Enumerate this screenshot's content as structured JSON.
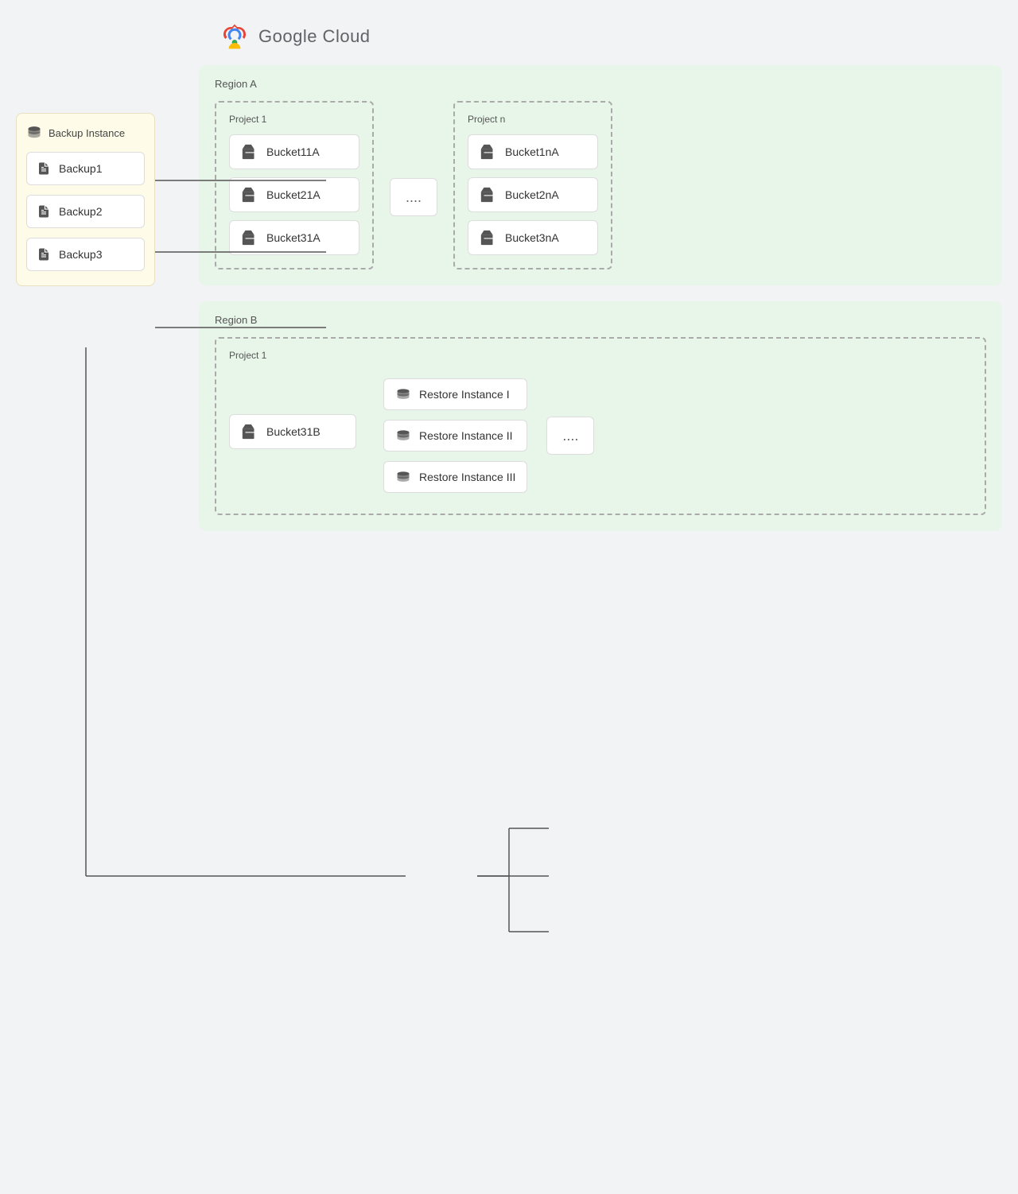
{
  "logo": {
    "text": "Google Cloud"
  },
  "backup_panel": {
    "title": "Backup Instance",
    "items": [
      {
        "id": "backup1",
        "label": "Backup1"
      },
      {
        "id": "backup2",
        "label": "Backup2"
      },
      {
        "id": "backup3",
        "label": "Backup3"
      }
    ]
  },
  "region_a": {
    "label": "Region A",
    "project1": {
      "label": "Project 1",
      "buckets": [
        {
          "id": "bucket11a",
          "label": "Bucket11A"
        },
        {
          "id": "bucket21a",
          "label": "Bucket21A"
        },
        {
          "id": "bucket31a",
          "label": "Bucket31A"
        }
      ]
    },
    "ellipsis": "....",
    "project_n": {
      "label": "Project n",
      "buckets": [
        {
          "id": "bucket1na",
          "label": "Bucket1nA"
        },
        {
          "id": "bucket2na",
          "label": "Bucket2nA"
        },
        {
          "id": "bucket3na",
          "label": "Bucket3nA"
        }
      ]
    }
  },
  "region_b": {
    "label": "Region B",
    "project1": {
      "label": "Project 1",
      "bucket": {
        "id": "bucket31b",
        "label": "Bucket31B"
      },
      "restore_instances": [
        {
          "id": "restore1",
          "label": "Restore Instance I"
        },
        {
          "id": "restore2",
          "label": "Restore Instance II"
        },
        {
          "id": "restore3",
          "label": "Restore Instance III"
        }
      ],
      "ellipsis": "...."
    }
  }
}
